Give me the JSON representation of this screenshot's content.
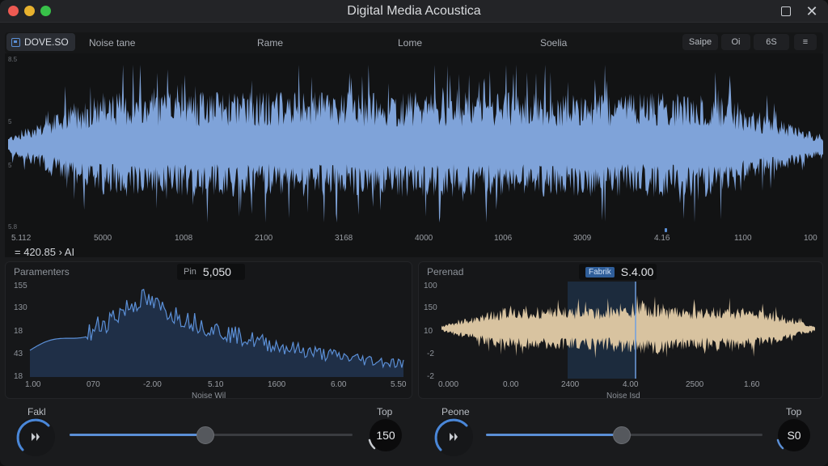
{
  "window": {
    "title": "Digital Media Acoustica"
  },
  "toolbar": {
    "preset_label": "DOVE.SO",
    "tabs": [
      "Noise tane",
      "Rame",
      "Lome",
      "Soelia"
    ],
    "right_buttons": [
      "Saipe",
      "Oi",
      "6S",
      "≡"
    ]
  },
  "main_wave": {
    "scale_labels": [
      "8.5",
      "5",
      "0",
      "5",
      "5.8"
    ],
    "ticks": [
      "5.112",
      "5000",
      "1008",
      "2100",
      "3168",
      "4000",
      "1006",
      "3009",
      "4.16",
      "1100",
      "100"
    ],
    "readout": "= 420.85 › AI",
    "color": "#7fa3d9"
  },
  "left_panel": {
    "title": "Paramenters",
    "read_key": "Pin",
    "read_value": "5,050",
    "y_labels": [
      "155",
      "130",
      "18",
      "43",
      "18"
    ],
    "x_labels": [
      "1.00",
      "070",
      "-2.00",
      "5.10",
      "1600",
      "6.00",
      "5.50"
    ],
    "axis_title": "Noise Wil",
    "color": "#5b8fd6"
  },
  "right_panel": {
    "title": "Perenad",
    "read_key": "Fabrik",
    "read_value": "S.4.00",
    "y_labels": [
      "100",
      "150",
      "10",
      "-2",
      "-2"
    ],
    "x_labels": [
      "0.000",
      "0.00",
      "2400",
      "4.00",
      "2500",
      "1.60"
    ],
    "axis_title": "Noise Isd",
    "color": "#d8c3a0"
  },
  "controls_left": {
    "dial_label": "Fakl",
    "top_label": "Top",
    "value": "150",
    "slider": 0.48
  },
  "controls_right": {
    "dial_label": "Peone",
    "top_label": "Top",
    "value": "S0",
    "slider": 0.49
  }
}
